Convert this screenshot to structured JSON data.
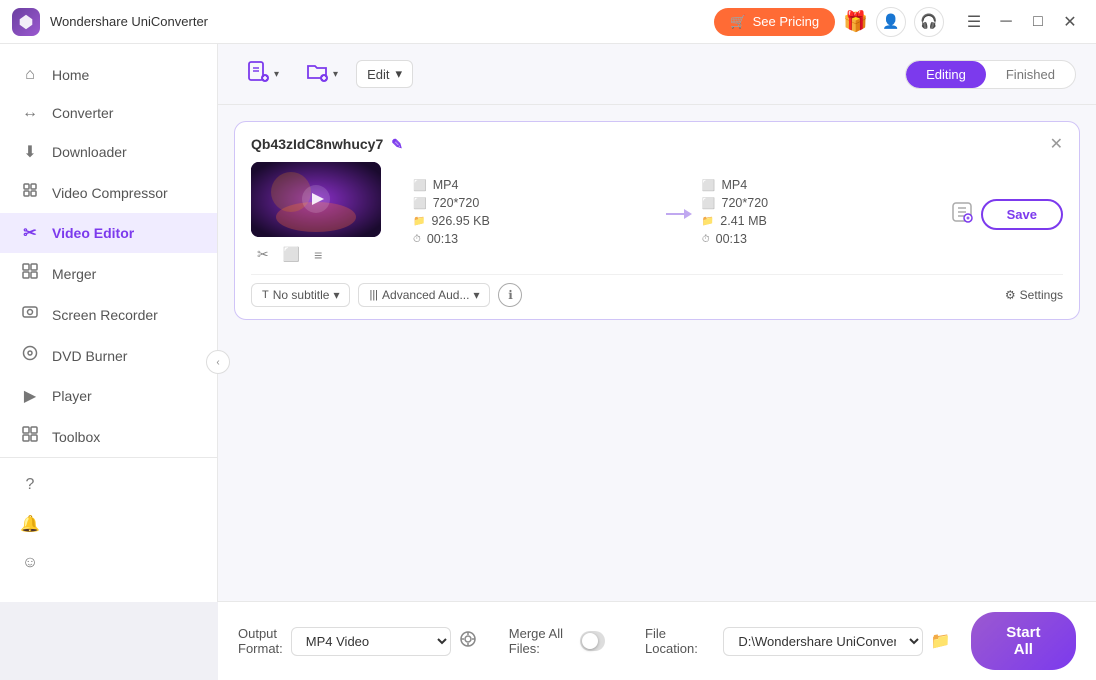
{
  "app": {
    "title": "Wondershare UniConverter",
    "logo_color": "#7c3aed"
  },
  "titlebar": {
    "see_pricing": "See Pricing",
    "cart_icon": "🛒",
    "gift_icon": "🎁",
    "profile_icon": "👤",
    "headset_icon": "🎧",
    "menu_icon": "☰",
    "minimize_icon": "─",
    "maximize_icon": "□",
    "close_icon": "✕"
  },
  "sidebar": {
    "items": [
      {
        "label": "Home",
        "icon": "⌂",
        "active": false
      },
      {
        "label": "Converter",
        "icon": "↔",
        "active": false
      },
      {
        "label": "Downloader",
        "icon": "⬇",
        "active": false
      },
      {
        "label": "Video Compressor",
        "icon": "⚙",
        "active": false
      },
      {
        "label": "Video Editor",
        "icon": "✂",
        "active": true
      },
      {
        "label": "Merger",
        "icon": "⊞",
        "active": false
      },
      {
        "label": "Screen Recorder",
        "icon": "⬡",
        "active": false
      },
      {
        "label": "DVD Burner",
        "icon": "⊙",
        "active": false
      },
      {
        "label": "Player",
        "icon": "▶",
        "active": false
      },
      {
        "label": "Toolbox",
        "icon": "⊞",
        "active": false
      }
    ],
    "bottom_items": [
      {
        "label": "Help",
        "icon": "?"
      },
      {
        "label": "Notifications",
        "icon": "🔔"
      },
      {
        "label": "Feedback",
        "icon": "☺"
      }
    ]
  },
  "toolbar": {
    "add_file_icon": "📄",
    "add_file_tooltip": "Add File",
    "add_folder_icon": "📁",
    "add_folder_tooltip": "Add Folder",
    "edit_label": "Edit",
    "edit_dropdown_arrow": "▾",
    "tab_editing": "Editing",
    "tab_finished": "Finished"
  },
  "file_card": {
    "filename": "Qb43zIdC8nwhucy7",
    "edit_icon": "✎",
    "close_icon": "✕",
    "source": {
      "format": "MP4",
      "resolution": "720*720",
      "size": "926.95 KB",
      "duration": "00:13"
    },
    "output": {
      "format": "MP4",
      "resolution": "720*720",
      "size": "2.41 MB",
      "duration": "00:13"
    },
    "cut_icon": "✂",
    "crop_icon": "⬜",
    "list_icon": "≡",
    "subtitle_label": "No subtitle",
    "audio_label": "Advanced Aud...",
    "info_icon": "ℹ",
    "settings_label": "Settings",
    "save_label": "Save",
    "settings_icon": "⚙"
  },
  "bottom_bar": {
    "output_format_label": "Output Format:",
    "output_format_value": "MP4 Video",
    "output_format_icon": "⚙",
    "file_location_label": "File Location:",
    "file_location_value": "D:\\Wondershare UniConverter",
    "file_location_icon": "📁",
    "merge_label": "Merge All Files:",
    "start_all_label": "Start All"
  }
}
